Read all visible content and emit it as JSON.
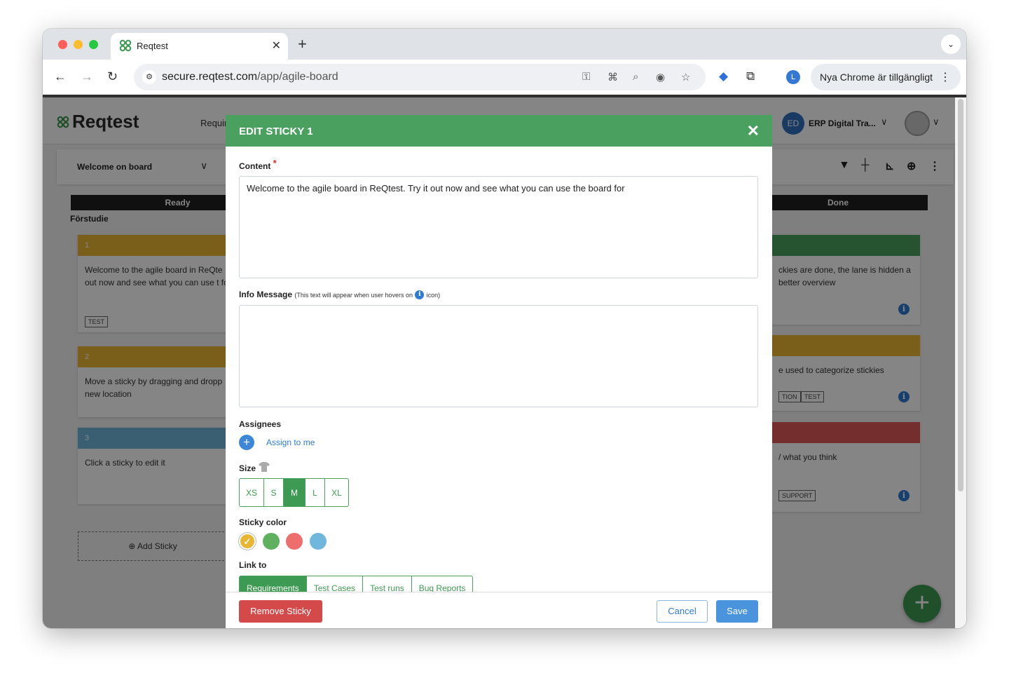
{
  "browser": {
    "tab_title": "Reqtest",
    "url_domain": "secure.reqtest.com",
    "url_path": "/app/agile-board",
    "profile_initial": "L",
    "update_chip": "Nya Chrome är tillgängligt"
  },
  "app": {
    "logo": "Reqtest",
    "nav_partial": "Requir",
    "org_initials": "ED",
    "org_name": "ERP Digital Tra...",
    "board_name": "Welcome on board",
    "lanes": [
      {
        "name": "Ready",
        "subheading": "Förstudie"
      },
      {
        "name": "Done"
      }
    ],
    "left_stickies": [
      {
        "number": "1",
        "text": "Welcome to the agile board in ReQte out now and see what you can use t for",
        "tag": "TEST"
      },
      {
        "number": "2",
        "text": "Move a sticky by dragging and dropp new location"
      },
      {
        "number": "3",
        "text": "Click a sticky to edit it"
      }
    ],
    "right_stickies": [
      {
        "text": "ckies are done, the lane is hidden a better overview"
      },
      {
        "text": "e used to categorize stickies",
        "tags": [
          "TION",
          "TEST"
        ]
      },
      {
        "text": "/ what you think",
        "tag": "SUPPORT"
      }
    ],
    "add_sticky": "Add Sticky",
    "colors": {
      "yellow": "#e8b632",
      "green": "#4aa15f",
      "red": "#e05858",
      "blue": "#6fb7dd"
    }
  },
  "modal": {
    "title": "EDIT STICKY 1",
    "content_label": "Content",
    "content_required": "*",
    "content_value": "Welcome to the agile board in ReQtest. Try it out now and see what you can use the board for",
    "info_label": "Info Message",
    "info_note_before": "(This text will appear when user hovers on",
    "info_note_after": "icon)",
    "info_value": "",
    "assignees_label": "Assignees",
    "assign_to_me": "Assign to me",
    "size_label": "Size",
    "sizes": [
      "XS",
      "S",
      "M",
      "L",
      "XL"
    ],
    "selected_size": "M",
    "color_label": "Sticky color",
    "link_label": "Link to",
    "link_tabs": [
      "Requirements",
      "Test Cases",
      "Test runs",
      "Bug Reports"
    ],
    "remove": "Remove Sticky",
    "cancel": "Cancel",
    "save": "Save"
  }
}
